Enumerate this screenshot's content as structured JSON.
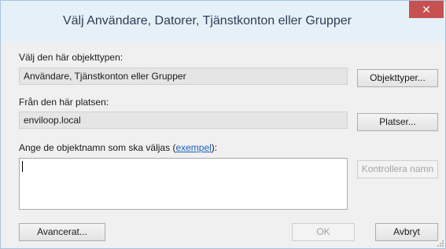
{
  "window": {
    "title": "Välj Användare, Datorer, Tjänstkonton eller Grupper",
    "close_glyph": "✕"
  },
  "object_type": {
    "label": "Välj den här objekttypen:",
    "value": "Användare, Tjänstkonton eller Grupper",
    "button": "Objekttyper..."
  },
  "location": {
    "label": "Från den här platsen:",
    "value": "enviloop.local",
    "button": "Platser..."
  },
  "names": {
    "label_prefix": "Ange de objektnamn som ska väljas (",
    "link": "exempel",
    "label_suffix": "):",
    "value": "",
    "check_button": "Kontrollera namn"
  },
  "footer": {
    "advanced_button": "Avancerat...",
    "ok_button": "OK",
    "cancel_button": "Avbryt"
  },
  "colors": {
    "close_button": "#c75050",
    "titlebar": "#e6f0f9",
    "link": "#1f5fbf"
  }
}
